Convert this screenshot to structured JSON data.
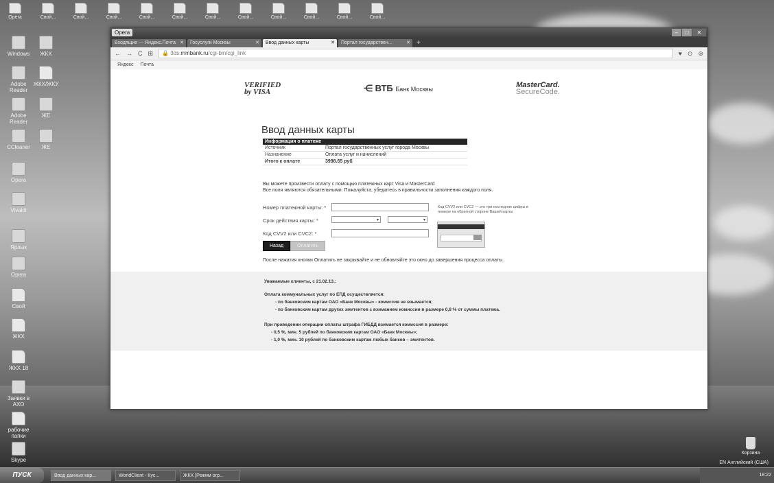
{
  "desktop": {
    "top_icons": [
      "Opera",
      "Свой...",
      "Свой...",
      "Свой...",
      "Свой...",
      "Свой...",
      "Свой...",
      "Свой...",
      "Свой...",
      "Свой...",
      "Свой...",
      "Свой..."
    ],
    "left_icons": [
      {
        "label": "Windows",
        "label2": "ЖКХ"
      },
      {
        "label": "Adobe Reader",
        "label2": "ЖКХ/ЖКУ"
      },
      {
        "label": "Adobe Reader",
        "label2": "ЖЕ"
      },
      {
        "label": "CCleaner",
        "label2": "ЖЕ"
      },
      {
        "label": "Opera"
      },
      {
        "label": "Vivaldi"
      },
      {
        "label": "Ярлык"
      },
      {
        "label": "Opera"
      },
      {
        "label": "Свой"
      },
      {
        "label": "ЖКХ"
      },
      {
        "label": "ЖКХ 18"
      },
      {
        "label": "Заявки в АХО"
      },
      {
        "label": "рабочие папки"
      },
      {
        "label": "Skype"
      }
    ],
    "recycle": "Корзина",
    "lang_bar": "EN Английский (США)"
  },
  "browser": {
    "opera_button": "Opera",
    "tabs": [
      {
        "label": "Входящие — Яндекс.Почта"
      },
      {
        "label": "Госуслуги Москвы"
      },
      {
        "label": "Ввод данных карты",
        "active": true
      },
      {
        "label": "Портал государствен..."
      }
    ],
    "url_prefix": "3ds.",
    "url_domain": "mmbank.ru",
    "url_path": "/cgi-bin/cgi_link",
    "bookmarks": [
      "Яндекс",
      "Почта"
    ]
  },
  "page": {
    "logo_visa_line1": "VERIFIED",
    "logo_visa_line2": "by VISA",
    "logo_vtb": "ВТБ",
    "logo_vtb_sub": "Банк Москвы",
    "logo_mc_line1": "MasterCard.",
    "logo_mc_line2": "SecureCode.",
    "title": "Ввод данных карты",
    "table_header": "Информация о платеже",
    "rows": [
      {
        "k": "Источник",
        "v": "Портал государственных услуг города Москвы"
      },
      {
        "k": "Назначение",
        "v": "Оплата услуг и начислений"
      },
      {
        "k": "Итого к оплате",
        "v": "3998.65 руб"
      }
    ],
    "info_line1": "Вы можете произвести оплату с помощью платежных карт Visa и MasterCard",
    "info_line2": "Все поля являются обязательными. Пожалуйста, убедитесь в правильности заполнения каждого поля.",
    "card_number_label": "Номер платежной карты: *",
    "expiry_label": "Срок действия карты: *",
    "cvv_label": "Код CVV2 или CVC2: *",
    "cvv_hint": "Код CVV2 или CVC2 — это три последние цифры в номере на обратной стороне Вашей карты",
    "btn_back": "Назад",
    "btn_pay": "Оплатить",
    "after_note": "После нажатия кнопки Оплатить не закрывайте и не обновляйте это окно до завершения процесса оплаты.",
    "notice_title": "Уважаемые клиенты, с 21.02.13.:",
    "notice_lines": [
      "Оплата коммунальных услуг по ЕПД осуществляется:",
      "- по банковским картам ОАО «Банк Москвы» - комиссия не взымается;",
      "- по банковским картам других эмитентов с взиманием комиссии в размере 0,8 % от суммы платежа.",
      "При проведении операции оплаты штрафа ГИБДД взимается комиссия в размере:",
      "- 0,5 %, мин. 5 рублей по банковским картам ОАО «Банк Москвы»;",
      "- 1,0 %, мин. 10 рублей по банковским картам любых банков – эмитентов."
    ]
  },
  "taskbar": {
    "start": "ПУСК",
    "tasks": [
      "Ввод данных кар...",
      "WorldClient - Кус...",
      "ЖКХ [Режим огр..."
    ],
    "clock": "18:22"
  }
}
